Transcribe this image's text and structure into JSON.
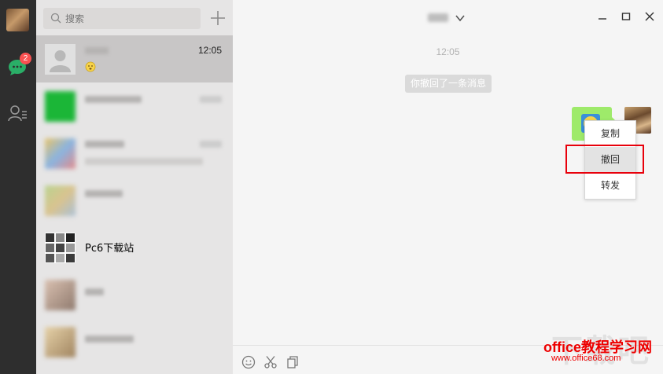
{
  "rail": {
    "unread_badge": "2"
  },
  "search": {
    "placeholder": "搜索"
  },
  "conversations": [
    {
      "name": "",
      "time": "12:05",
      "preview": "",
      "active": true
    },
    {
      "name": "",
      "time": "",
      "preview": ""
    },
    {
      "name": "",
      "time": "",
      "preview": ""
    },
    {
      "name": "",
      "time": "",
      "preview": ""
    },
    {
      "name": "Pc6下载站",
      "time": "",
      "preview": ""
    },
    {
      "name": "",
      "time": "",
      "preview": ""
    },
    {
      "name": "",
      "time": "",
      "preview": ""
    }
  ],
  "chat": {
    "timestamp": "12:05",
    "recall_notice": "你撤回了一条消息"
  },
  "context_menu": {
    "items": [
      "复制",
      "撤回",
      "转发"
    ],
    "highlighted": "撤回"
  },
  "watermark": {
    "main": "office教程学习网",
    "sub": "www.office68.com"
  },
  "colors": {
    "rail_bg": "#2e2e2e",
    "badge": "#fa5151",
    "bubble": "#9eea6a",
    "highlight_box": "#e8000b"
  }
}
